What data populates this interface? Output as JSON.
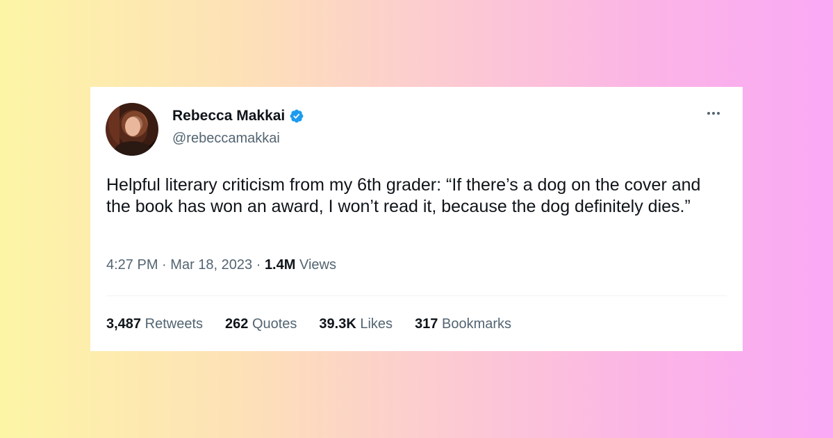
{
  "tweet": {
    "author": {
      "display_name": "Rebecca Makkai",
      "handle": "@rebeccamakkai",
      "verified": true,
      "verified_color": "#1d9bf0"
    },
    "text": "Helpful literary criticism from my 6th grader: “If there’s a dog on the cover and the book has won an award, I won’t read it, because the dog definitely dies.”",
    "time": "4:27 PM",
    "date": "Mar 18, 2023",
    "separator": "·",
    "views_count": "1.4M",
    "views_label": "Views",
    "stats": [
      {
        "count": "3,487",
        "label": "Retweets"
      },
      {
        "count": "262",
        "label": "Quotes"
      },
      {
        "count": "39.3K",
        "label": "Likes"
      },
      {
        "count": "317",
        "label": "Bookmarks"
      }
    ],
    "more_icon": "more-horizontal-icon"
  }
}
